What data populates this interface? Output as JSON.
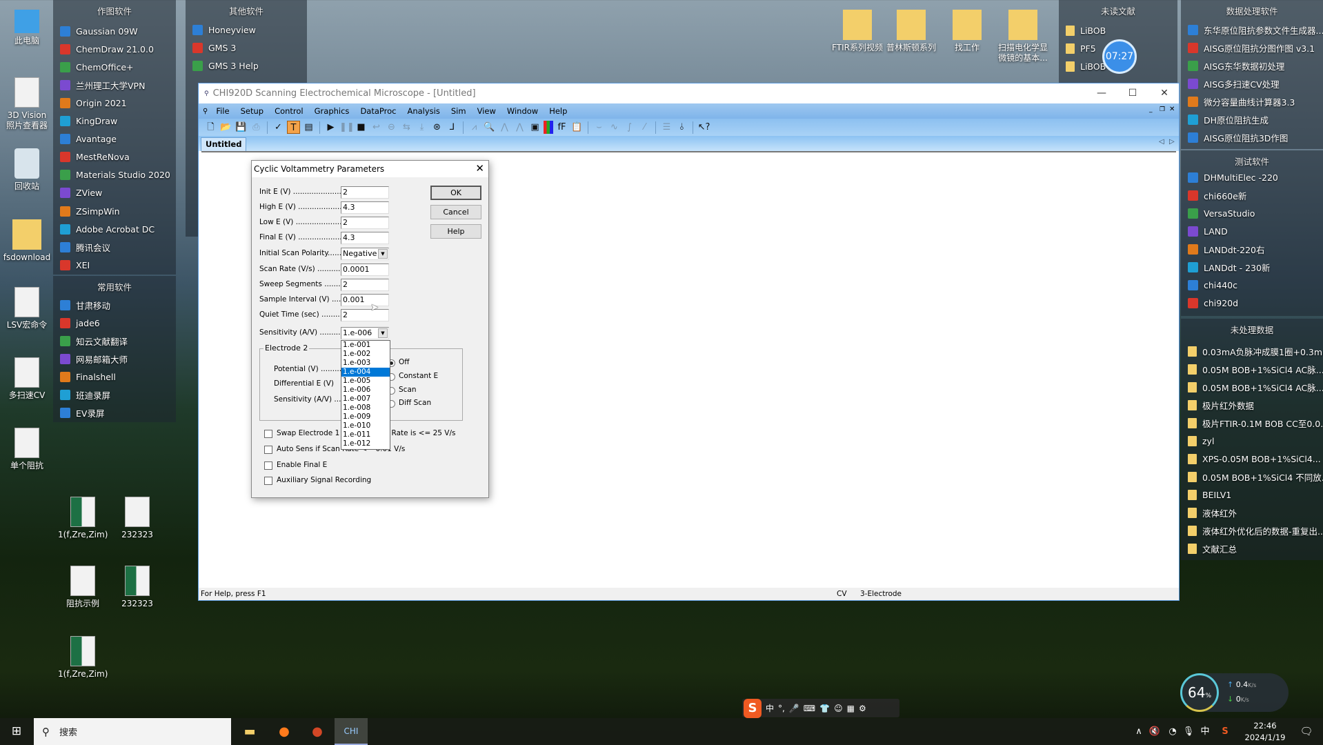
{
  "desktop_left": [
    {
      "label": "此电脑",
      "kind": "pc"
    },
    {
      "label": "3D Vision 照片查看器",
      "kind": "app"
    },
    {
      "label": "回收站",
      "kind": "bin"
    },
    {
      "label": "fsdownload",
      "kind": "fold"
    },
    {
      "label": "LSV宏命令",
      "kind": "doc"
    },
    {
      "label": "多扫速CV",
      "kind": "doc"
    },
    {
      "label": "单个阻抗",
      "kind": "doc"
    }
  ],
  "desktop_files": [
    {
      "label": "1(f,Zre,Zim)",
      "kind": "xl"
    },
    {
      "label": "232323",
      "kind": "doc"
    },
    {
      "label": "阻抗示例",
      "kind": "doc"
    },
    {
      "label": "232323",
      "kind": "xl"
    },
    {
      "label": "1(f,Zre,Zim)",
      "kind": "xl"
    }
  ],
  "desktop_top": [
    {
      "label": "FTIR系列视频"
    },
    {
      "label": "普林斯顿系列"
    },
    {
      "label": "找工作"
    },
    {
      "label": "扫描电化学显微镜的基本..."
    }
  ],
  "panel_drawing": {
    "title": "作图软件",
    "items": [
      "Gaussian 09W",
      "ChemDraw 21.0.0",
      "ChemOffice+",
      "兰州理工大学VPN",
      "Origin 2021",
      "KingDraw",
      "Avantage",
      "MestReNova",
      "Materials Studio 2020",
      "ZView",
      "ZSimpWin",
      "Adobe Acrobat DC",
      "腾讯会议",
      "XEI"
    ]
  },
  "panel_common": {
    "title": "常用软件",
    "items": [
      "甘肃移动",
      "jade6",
      "知云文献翻译",
      "网易邮箱大师",
      "Finalshell",
      "班迪录屏",
      "EV录屏"
    ]
  },
  "panel_other": {
    "title": "其他软件",
    "items": [
      "Honeyview",
      "GMS 3",
      "GMS 3 Help"
    ]
  },
  "panel_unread": {
    "title": "未读文献",
    "items": [
      "LiBOB",
      "PF5",
      "LiBOB-L"
    ]
  },
  "clock_widget": "07:27",
  "panel_data": {
    "title": "数据处理软件",
    "items": [
      "东华原位阻抗参数文件生成器...",
      "AISG原位阻抗分图作图 v3.1",
      "AISG东华数据初处理",
      "AISG多扫速CV处理",
      "微分容量曲线计算器3.3",
      "DH原位阻抗生成",
      "AISG原位阻抗3D作图"
    ]
  },
  "panel_test": {
    "title": "测试软件",
    "items": [
      "DHMultiElec -220",
      "chi660e新",
      "VersaStudio",
      "LAND",
      "LANDdt-220右",
      "LANDdt - 230新",
      "chi440c",
      "chi920d"
    ]
  },
  "panel_raw": {
    "title": "未处理数据",
    "items": [
      "0.03mA负脉冲成膜1圈+0.3m...",
      "0.05M BOB+1%SiCl4 AC脉...",
      "0.05M BOB+1%SiCl4 AC脉...",
      "极片红外数据",
      "极片FTIR-0.1M BOB CC至0.0...",
      "zyl",
      "XPS-0.05M BOB+1%SiCl4...",
      "0.05M BOB+1%SiCl4 不同放...",
      "BEILV1",
      "液体红外",
      "液体红外优化后的数据-重复出...",
      "文献汇总"
    ]
  },
  "app": {
    "title": "CHI920D Scanning Electrochemical Microscope - [Untitled]",
    "menu": [
      "File",
      "Setup",
      "Control",
      "Graphics",
      "DataProc",
      "Analysis",
      "Sim",
      "View",
      "Window",
      "Help"
    ],
    "toolbar": [
      {
        "icon": "new-file-icon",
        "g": "🗋"
      },
      {
        "icon": "open-folder-icon",
        "g": "📂"
      },
      {
        "icon": "save-icon",
        "g": "💾",
        "dis": true
      },
      {
        "icon": "print-icon",
        "g": "⎙",
        "dis": true
      },
      {
        "sep": true
      },
      {
        "icon": "system-check-icon",
        "g": "✓"
      },
      {
        "icon": "technique-icon",
        "g": "T",
        "act": true
      },
      {
        "icon": "parameters-icon",
        "g": "▤"
      },
      {
        "sep": true
      },
      {
        "icon": "run-icon",
        "g": "▶"
      },
      {
        "icon": "pause-icon",
        "g": "❚❚",
        "dis": true
      },
      {
        "icon": "stop-icon",
        "g": "■"
      },
      {
        "icon": "reverse-icon",
        "g": "↩",
        "dis": true
      },
      {
        "icon": "filter-icon",
        "g": "⊖",
        "dis": true
      },
      {
        "icon": "ir-comp-icon",
        "g": "⇆",
        "dis": true
      },
      {
        "icon": "rotate-icon",
        "g": "⤓",
        "dis": true
      },
      {
        "icon": "cell-icon",
        "g": "⊛"
      },
      {
        "icon": "axes-icon",
        "g": "⅃"
      },
      {
        "sep": true
      },
      {
        "icon": "graph-icon",
        "g": "⩘",
        "dis": true
      },
      {
        "icon": "zoom-icon",
        "g": "🔍",
        "dis": true
      },
      {
        "icon": "peak-icon",
        "g": "⋀",
        "dis": true
      },
      {
        "icon": "overlay-icon",
        "g": "⋀",
        "dis": true
      },
      {
        "icon": "display-icon",
        "g": "▣"
      },
      {
        "icon": "color-icon",
        "g": "▮"
      },
      {
        "icon": "font-icon",
        "g": "fF"
      },
      {
        "icon": "clipboard-icon",
        "g": "📋"
      },
      {
        "sep": true
      },
      {
        "icon": "smooth-icon",
        "g": "⌣",
        "dis": true
      },
      {
        "icon": "derivative-icon",
        "g": "∿",
        "dis": true
      },
      {
        "icon": "integrate-icon",
        "g": "∫",
        "dis": true
      },
      {
        "icon": "probe-icon",
        "g": "⁄",
        "dis": true
      },
      {
        "sep": true
      },
      {
        "icon": "text-report-icon",
        "g": "☰",
        "dis": true
      },
      {
        "icon": "tip-icon",
        "g": "⫰"
      },
      {
        "sep": true
      },
      {
        "icon": "context-help-icon",
        "g": "↖?"
      }
    ],
    "tab": "Untitled",
    "status": {
      "help": "For Help, press F1",
      "technique": "CV",
      "electrode": "3-Electrode"
    }
  },
  "dialog": {
    "title": "Cyclic Voltammetry Parameters",
    "fields": [
      {
        "label": "Init E (V) ........................",
        "value": "2"
      },
      {
        "label": "High E (V) .....................",
        "value": "4.3"
      },
      {
        "label": "Low E (V) ......................",
        "value": "2"
      },
      {
        "label": "Final E (V) ....................",
        "value": "4.3"
      },
      {
        "label": "Initial Scan Polarity........",
        "value": "Negative",
        "combo": true
      },
      {
        "label": "Scan Rate (V/s) ...........",
        "value": "0.0001"
      },
      {
        "label": "Sweep Segments ..........",
        "value": "2"
      },
      {
        "label": "Sample Interval (V) .......",
        "value": "0.001"
      },
      {
        "label": "Quiet Time (sec) ...........",
        "value": "2"
      },
      {
        "label": "Sensitivity (A/V) ............",
        "value": "1.e-006",
        "combo": true
      }
    ],
    "buttons": {
      "ok": "OK",
      "cancel": "Cancel",
      "help": "Help"
    },
    "electrode2": {
      "title": "Electrode 2",
      "labels": [
        "Potential (V) ...........",
        "Differential E (V)",
        "Sensitivity (A/V) ....."
      ],
      "modes": [
        {
          "label": "Off",
          "selected": true
        },
        {
          "label": "Constant E",
          "selected": false
        },
        {
          "label": "Scan",
          "selected": false
        },
        {
          "label": "Diff Scan",
          "selected": false
        }
      ]
    },
    "checks": [
      {
        "label": "Swap Electrode 1 and 2 if Scan Rate is <= 25 V/s",
        "checked": false
      },
      {
        "label": "Auto Sens if Scan Rate <= 0.01 V/s",
        "checked": false
      },
      {
        "label": "Enable Final E",
        "checked": false
      },
      {
        "label": "Auxiliary Signal Recording",
        "checked": false
      }
    ],
    "sensitivity_options": [
      "1.e-001",
      "1.e-002",
      "1.e-003",
      "1.e-004",
      "1.e-005",
      "1.e-006",
      "1.e-007",
      "1.e-008",
      "1.e-009",
      "1.e-010",
      "1.e-011",
      "1.e-012"
    ],
    "highlighted_option": "1.e-004"
  },
  "net_widget": {
    "cpu": "64",
    "unit": "%",
    "up": "0.4",
    "down": "0",
    "rate_unit": "K/s"
  },
  "ime_bar": [
    "中",
    "°,",
    "🎤",
    "⌨",
    "👕",
    "☺",
    "▦",
    "⚙"
  ],
  "taskbar": {
    "search_placeholder": "搜索",
    "tray": {
      "ime": "中",
      "time": "22:46",
      "date": "2024/1/19"
    }
  }
}
